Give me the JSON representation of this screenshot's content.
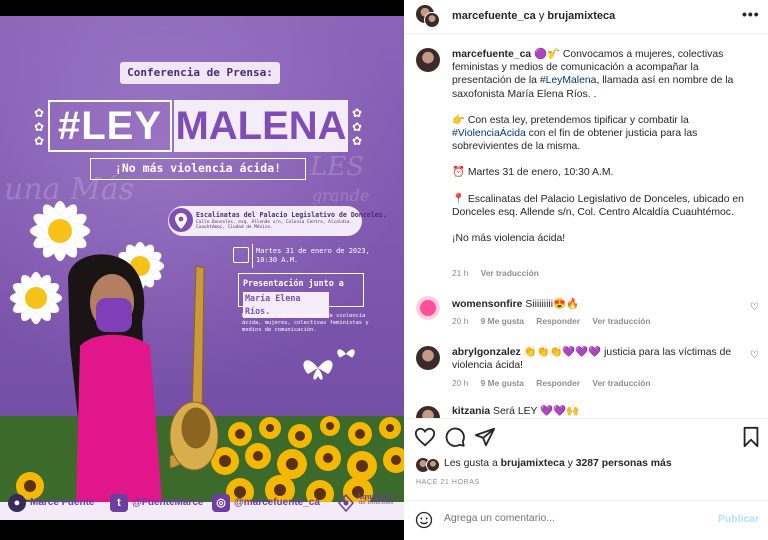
{
  "poster": {
    "conference": "Conferencia de Prensa:",
    "ley": "#LEY",
    "malena": "MALENA",
    "slogan": "¡No más violencia ácida!",
    "graffiti": [
      "una Más",
      "LES",
      "grande"
    ],
    "location_title": "Escalinatas del Palacio Legislativo de Donceles.",
    "location_detail": "Calle Donceles, esq. Allende s/n, Colonia Centro, Alcaldía Cuauhtémoc, Ciudad de México.",
    "date_line1": "Martes 31 de enero de 2023,",
    "date_line2": "10:30 A.M.",
    "presentation_line1": "Presentación junto a",
    "presentation_line2": "María Elena Ríos.",
    "audience": "Dirigido a sobrevivientes de violencia ácida, mujeres, colectivas feministas y medios de comunicación.",
    "footer": {
      "name": "Marce Fuente",
      "twitter": "@FuenteMarce",
      "instagram": "@marcefuente_ca",
      "org_line1": "Aquelarre",
      "org_line2": "de Donceles"
    }
  },
  "header": {
    "user1": "marcefuente_ca",
    "conj": "y",
    "user2": "brujamixteca",
    "more": "•••"
  },
  "caption": {
    "user": "marcefuente_ca",
    "emoji": "🟣🎷",
    "p1a": "Convocamos a mujeres, colectivas feministas y medios de comunicación a acompañar la presentación de la",
    "tag1": "#LeyMalena",
    "p1b": ", llamada así en nombre de la saxofonista María Elena Ríos. .",
    "p2a": "👉 Con esta ley, pretendemos tipificar y combatir la",
    "tag2": "#ViolenciaÁcida",
    "p2b": "con el fin de obtener justicia para las sobrevivientes de la misma.",
    "p3": "⏰ Martes 31 de enero, 10:30 A.M.",
    "p4": "📍 Escalinatas del Palacio Legislativo de Donceles, ubicado en Donceles esq. Allende s/n, Col. Centro Alcaldía Cuauhtémoc.",
    "p5": "¡No más violencia ácida!",
    "time": "21 h",
    "translate": "Ver traducción"
  },
  "comments": [
    {
      "user": "womensonfire",
      "text": "Siiiiiiiii😍🔥",
      "time": "20 h",
      "likes": "9 Me gusta",
      "reply": "Responder",
      "translate": "Ver traducción"
    },
    {
      "user": "abrylgonzalez",
      "text": "👏👏👏💜💜💜 justicia para las víctimas de violencia ácida!",
      "time": "20 h",
      "likes": "9 Me gusta",
      "reply": "Responder",
      "translate": "Ver traducción"
    },
    {
      "user": "kitzania",
      "text": "Será LEY 💜💜🙌"
    }
  ],
  "likes": {
    "prefix": "Les gusta a",
    "user": "brujamixteca",
    "mid": "y",
    "count": "3287 personas más"
  },
  "ago": "HACE 21 HORAS",
  "comment_box": {
    "placeholder": "Agrega un comentario...",
    "publish": "Publicar"
  },
  "colors": {
    "poster_purple": "#7d55ad",
    "link": "#00376b",
    "muted": "#8e8e8e",
    "publish": "#b2dffc"
  }
}
